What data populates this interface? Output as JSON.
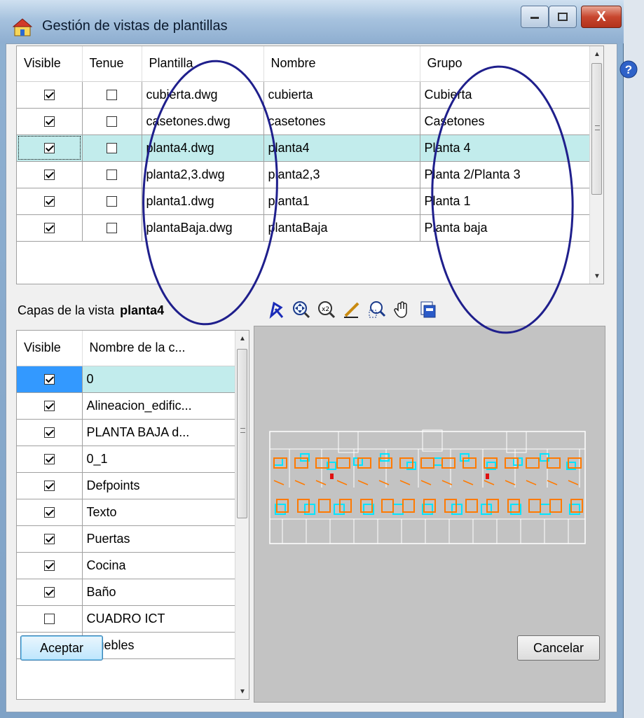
{
  "window": {
    "title": "Gestión de vistas de plantillas",
    "minimize_label": "minimize",
    "maximize_label": "maximize",
    "close_label": "X"
  },
  "toolbar": {
    "buttons": [
      "add-icon",
      "delete-icon",
      "copy-icon",
      "arrow-up-icon",
      "arrow-down-icon",
      "redirect-icon",
      "layers-check-icon",
      "dxf-dwg-icon",
      "open-folder-icon",
      "save-icon"
    ]
  },
  "templates": {
    "headers": {
      "visible": "Visible",
      "tenue": "Tenue",
      "plantilla": "Plantilla",
      "nombre": "Nombre",
      "grupo": "Grupo"
    },
    "rows": [
      {
        "visible": true,
        "tenue": false,
        "plantilla": "cubierta.dwg",
        "nombre": "cubierta",
        "grupo": "Cubierta"
      },
      {
        "visible": true,
        "tenue": false,
        "plantilla": "casetones.dwg",
        "nombre": "casetones",
        "grupo": "Casetones"
      },
      {
        "visible": true,
        "tenue": false,
        "plantilla": "planta4.dwg",
        "nombre": "planta4",
        "grupo": "Planta 4",
        "selected": true
      },
      {
        "visible": true,
        "tenue": false,
        "plantilla": "planta2,3.dwg",
        "nombre": "planta2,3",
        "grupo": "Planta 2/Planta 3"
      },
      {
        "visible": true,
        "tenue": false,
        "plantilla": "planta1.dwg",
        "nombre": "planta1",
        "grupo": "Planta 1"
      },
      {
        "visible": true,
        "tenue": false,
        "plantilla": "plantaBaja.dwg",
        "nombre": "plantaBaja",
        "grupo": "Planta baja"
      }
    ]
  },
  "layers": {
    "label": "Capas de la vista",
    "view_name": "planta4",
    "headers": {
      "visible": "Visible",
      "nombre": "Nombre de la c..."
    },
    "rows": [
      {
        "visible": true,
        "name": "0",
        "selected": true
      },
      {
        "visible": true,
        "name": "Alineacion_edific..."
      },
      {
        "visible": true,
        "name": "PLANTA BAJA d..."
      },
      {
        "visible": true,
        "name": "0_1"
      },
      {
        "visible": true,
        "name": "Defpoints"
      },
      {
        "visible": true,
        "name": "Texto"
      },
      {
        "visible": true,
        "name": "Puertas"
      },
      {
        "visible": true,
        "name": "Cocina"
      },
      {
        "visible": true,
        "name": "Baño"
      },
      {
        "visible": false,
        "name": "CUADRO ICT"
      },
      {
        "visible": true,
        "name": "Muebles"
      }
    ]
  },
  "view_tools": [
    "select-region-icon",
    "zoom-extents-icon",
    "zoom-x2-icon",
    "pen-icon",
    "zoom-window-icon",
    "pan-hand-icon",
    "copy-view-icon"
  ],
  "buttons": {
    "ok": "Aceptar",
    "cancel": "Cancelar"
  },
  "colors": {
    "selection": "#c2ecec",
    "annotation": "#1f1f8c",
    "plan_orange": "#ff7a00",
    "plan_cyan": "#00e5ff",
    "preview_bg": "#c3c3c3"
  }
}
